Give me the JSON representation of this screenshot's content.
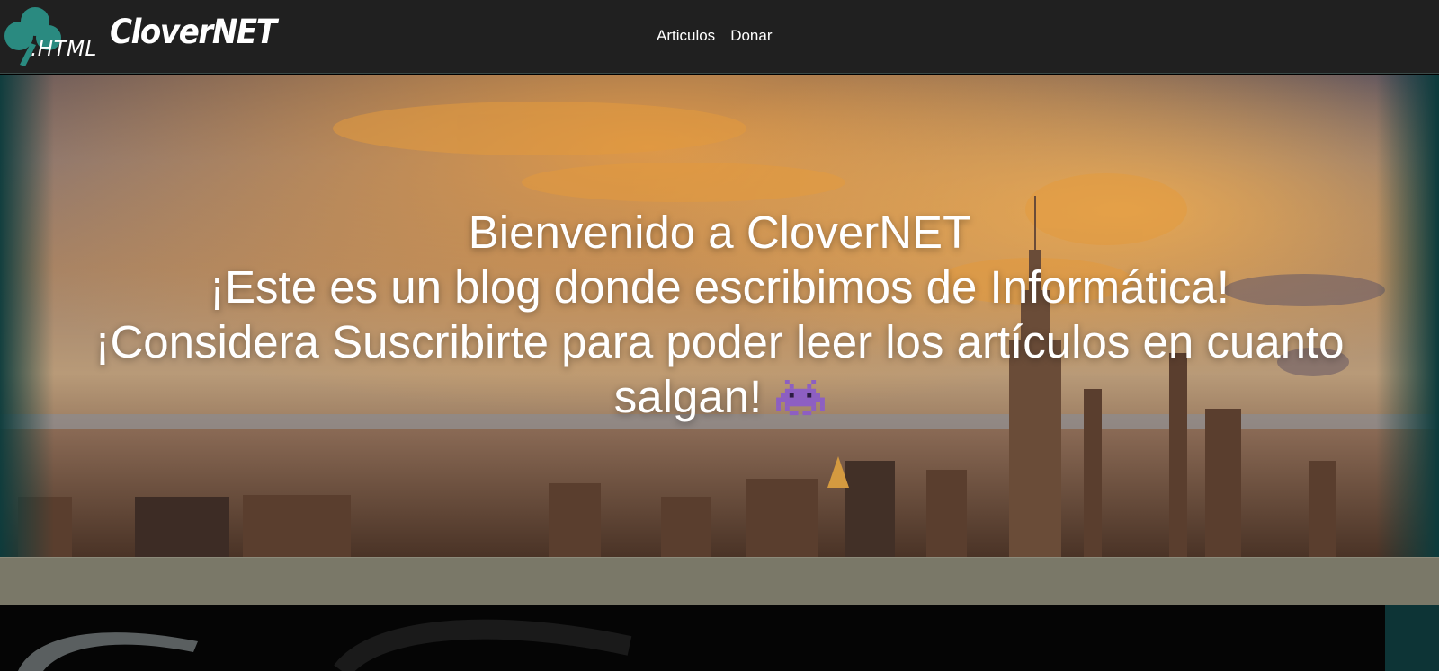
{
  "header": {
    "logo_text": ".HTML",
    "brand": "CloverNET",
    "nav": [
      {
        "label": "Articulos"
      },
      {
        "label": "Donar"
      }
    ]
  },
  "hero": {
    "line1": "Bienvenido a CloverNET",
    "line2": "¡Este es un blog donde escribimos de Informática!",
    "line3": "¡Considera Suscribirte para poder leer los artículos en cuanto salgan!",
    "emoji_icon": "alien-monster-icon"
  },
  "colors": {
    "navbar_bg": "#202020",
    "logo_clover": "#2a8a80",
    "strip": "#7a7868",
    "footer": "#050505"
  }
}
